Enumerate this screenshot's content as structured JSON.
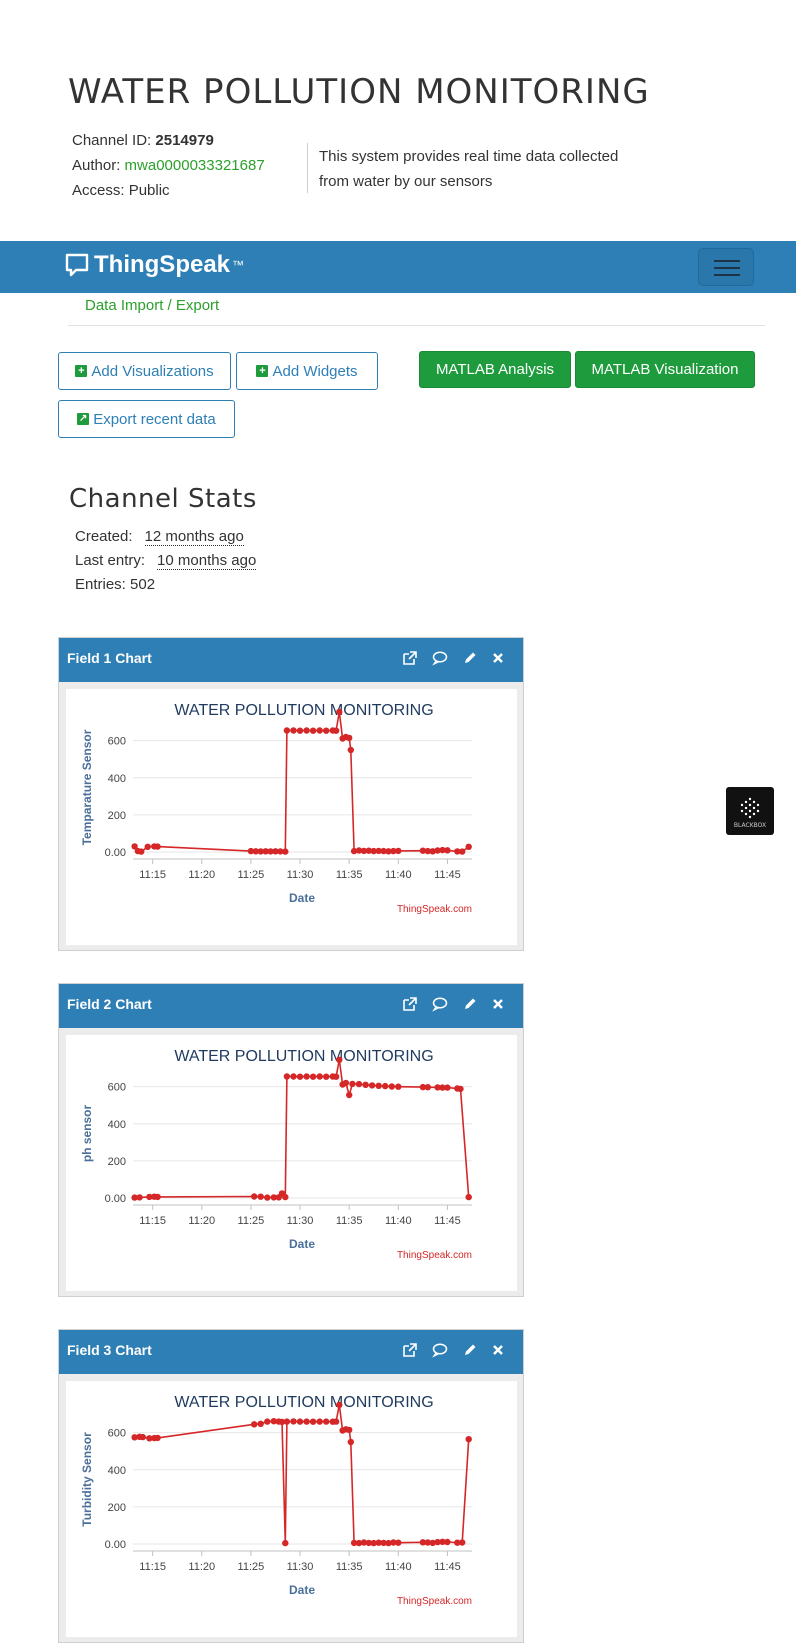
{
  "page": {
    "title": "WATER POLLUTION MONITORING",
    "channel_id_label": "Channel ID:",
    "channel_id": "2514979",
    "author_label": "Author:",
    "author": "mwa0000033321687",
    "access_label": "Access:",
    "access": "Public",
    "description": "This system provides real time data collected from water by our sensors"
  },
  "navbar": {
    "brand": "ThingSpeak",
    "brand_tm": "™",
    "subnav_link": "Data Import / Export"
  },
  "buttons": {
    "add_visualizations": "Add Visualizations",
    "add_widgets": "Add Widgets",
    "matlab_analysis": "MATLAB Analysis",
    "matlab_visualization": "MATLAB Visualization",
    "export_recent": "Export recent data"
  },
  "stats": {
    "title": "Channel Stats",
    "created_label": "Created:",
    "created": "12 months ago",
    "last_entry_label": "Last entry:",
    "last_entry": "10 months ago",
    "entries_label": "Entries:",
    "entries": "502"
  },
  "widget": {
    "label": "BLACKBOX"
  },
  "colors": {
    "navbar": "#2e7fb6",
    "green": "#1e9b3c",
    "series": "#d62728",
    "chart_title": "#1f3a5f"
  },
  "chart_data": [
    {
      "type": "line",
      "panel_title": "Field 1 Chart",
      "title": "WATER POLLUTION MONITORING",
      "xlabel": "Date",
      "ylabel": "Temparature Sensor",
      "credit": "ThingSpeak.com",
      "xlim": [
        "11:13",
        "11:47:30"
      ],
      "ylim": [
        0,
        760
      ],
      "yticks": [
        "0.00",
        "200",
        "400",
        "600"
      ],
      "xticks": [
        "11:15",
        "11:20",
        "11:25",
        "11:30",
        "11:35",
        "11:40",
        "11:45"
      ],
      "series": [
        {
          "values": [
            [
              "11:13:10",
              30
            ],
            [
              "11:13:30",
              5
            ],
            [
              "11:13:50",
              2
            ],
            [
              "11:14:30",
              28
            ],
            [
              "11:15:10",
              30
            ],
            [
              "11:15:30",
              29
            ],
            [
              "11:25:00",
              5
            ],
            [
              "11:25:30",
              4
            ],
            [
              "11:26:00",
              3
            ],
            [
              "11:26:30",
              4
            ],
            [
              "11:27:00",
              3
            ],
            [
              "11:27:30",
              4
            ],
            [
              "11:28:00",
              3
            ],
            [
              "11:28:30",
              2
            ],
            [
              "11:28:40",
              655
            ],
            [
              "11:29:20",
              655
            ],
            [
              "11:30:00",
              654
            ],
            [
              "11:30:40",
              655
            ],
            [
              "11:31:20",
              654
            ],
            [
              "11:32:00",
              655
            ],
            [
              "11:32:40",
              654
            ],
            [
              "11:33:20",
              655
            ],
            [
              "11:33:40",
              654
            ],
            [
              "11:34:00",
              755
            ],
            [
              "11:34:20",
              612
            ],
            [
              "11:34:40",
              620
            ],
            [
              "11:35:00",
              615
            ],
            [
              "11:35:10",
              550
            ],
            [
              "11:35:30",
              5
            ],
            [
              "11:36:00",
              8
            ],
            [
              "11:36:30",
              6
            ],
            [
              "11:37:00",
              7
            ],
            [
              "11:37:30",
              5
            ],
            [
              "11:38:00",
              6
            ],
            [
              "11:38:30",
              5
            ],
            [
              "11:39:00",
              4
            ],
            [
              "11:39:30",
              5
            ],
            [
              "11:40:00",
              6
            ],
            [
              "11:42:30",
              7
            ],
            [
              "11:43:00",
              5
            ],
            [
              "11:43:30",
              4
            ],
            [
              "11:44:00",
              8
            ],
            [
              "11:44:30",
              10
            ],
            [
              "11:45:00",
              9
            ],
            [
              "11:46:00",
              3
            ],
            [
              "11:46:30",
              2
            ],
            [
              "11:47:10",
              28
            ]
          ]
        }
      ]
    },
    {
      "type": "line",
      "panel_title": "Field 2 Chart",
      "title": "WATER POLLUTION MONITORING",
      "xlabel": "Date",
      "ylabel": "ph sensor",
      "credit": "ThingSpeak.com",
      "xlim": [
        "11:13",
        "11:47:30"
      ],
      "ylim": [
        0,
        760
      ],
      "yticks": [
        "0.00",
        "200",
        "400",
        "600"
      ],
      "xticks": [
        "11:15",
        "11:20",
        "11:25",
        "11:30",
        "11:35",
        "11:40",
        "11:45"
      ],
      "series": [
        {
          "values": [
            [
              "11:13:10",
              2
            ],
            [
              "11:13:40",
              3
            ],
            [
              "11:14:40",
              6
            ],
            [
              "11:15:10",
              7
            ],
            [
              "11:15:30",
              6
            ],
            [
              "11:25:20",
              8
            ],
            [
              "11:26:00",
              7
            ],
            [
              "11:26:40",
              2
            ],
            [
              "11:27:20",
              3
            ],
            [
              "11:27:50",
              4
            ],
            [
              "11:28:10",
              25
            ],
            [
              "11:28:30",
              5
            ],
            [
              "11:28:40",
              655
            ],
            [
              "11:29:20",
              655
            ],
            [
              "11:30:00",
              654
            ],
            [
              "11:30:40",
              655
            ],
            [
              "11:31:20",
              654
            ],
            [
              "11:32:00",
              655
            ],
            [
              "11:32:40",
              654
            ],
            [
              "11:33:20",
              655
            ],
            [
              "11:33:40",
              654
            ],
            [
              "11:34:00",
              745
            ],
            [
              "11:34:20",
              612
            ],
            [
              "11:34:40",
              620
            ],
            [
              "11:35:00",
              555
            ],
            [
              "11:35:20",
              615
            ],
            [
              "11:36:00",
              614
            ],
            [
              "11:36:40",
              610
            ],
            [
              "11:37:20",
              607
            ],
            [
              "11:38:00",
              605
            ],
            [
              "11:38:40",
              603
            ],
            [
              "11:39:20",
              601
            ],
            [
              "11:40:00",
              600
            ],
            [
              "11:42:30",
              598
            ],
            [
              "11:43:00",
              597
            ],
            [
              "11:44:00",
              596
            ],
            [
              "11:44:30",
              595
            ],
            [
              "11:45:00",
              595
            ],
            [
              "11:46:00",
              590
            ],
            [
              "11:46:20",
              588
            ],
            [
              "11:47:10",
              5
            ]
          ]
        }
      ]
    },
    {
      "type": "line",
      "panel_title": "Field 3 Chart",
      "title": "WATER POLLUTION MONITORING",
      "xlabel": "Date",
      "ylabel": "Turbidity Sensor",
      "credit": "ThingSpeak.com",
      "xlim": [
        "11:13",
        "11:47:30"
      ],
      "ylim": [
        0,
        760
      ],
      "yticks": [
        "0.00",
        "200",
        "400",
        "600"
      ],
      "xticks": [
        "11:15",
        "11:20",
        "11:25",
        "11:30",
        "11:35",
        "11:40",
        "11:45"
      ],
      "series": [
        {
          "values": [
            [
              "11:13:10",
              575
            ],
            [
              "11:13:40",
              578
            ],
            [
              "11:14:00",
              576
            ],
            [
              "11:14:40",
              570
            ],
            [
              "11:15:10",
              571
            ],
            [
              "11:15:30",
              572
            ],
            [
              "11:25:20",
              645
            ],
            [
              "11:26:00",
              648
            ],
            [
              "11:26:40",
              660
            ],
            [
              "11:27:20",
              662
            ],
            [
              "11:27:50",
              660
            ],
            [
              "11:28:10",
              658
            ],
            [
              "11:28:30",
              5
            ],
            [
              "11:28:40",
              660
            ],
            [
              "11:29:20",
              661
            ],
            [
              "11:30:00",
              660
            ],
            [
              "11:30:40",
              660
            ],
            [
              "11:31:20",
              659
            ],
            [
              "11:32:00",
              660
            ],
            [
              "11:32:40",
              660
            ],
            [
              "11:33:20",
              659
            ],
            [
              "11:33:40",
              660
            ],
            [
              "11:34:00",
              750
            ],
            [
              "11:34:20",
              612
            ],
            [
              "11:34:40",
              618
            ],
            [
              "11:35:00",
              615
            ],
            [
              "11:35:10",
              550
            ],
            [
              "11:35:30",
              6
            ],
            [
              "11:36:00",
              5
            ],
            [
              "11:36:30",
              8
            ],
            [
              "11:37:00",
              6
            ],
            [
              "11:37:30",
              5
            ],
            [
              "11:38:00",
              7
            ],
            [
              "11:38:30",
              6
            ],
            [
              "11:39:00",
              5
            ],
            [
              "11:39:30",
              8
            ],
            [
              "11:40:00",
              7
            ],
            [
              "11:42:30",
              9
            ],
            [
              "11:43:00",
              8
            ],
            [
              "11:43:30",
              6
            ],
            [
              "11:44:00",
              10
            ],
            [
              "11:44:30",
              12
            ],
            [
              "11:45:00",
              11
            ],
            [
              "11:46:00",
              7
            ],
            [
              "11:46:30",
              8
            ],
            [
              "11:47:10",
              565
            ]
          ]
        }
      ]
    }
  ]
}
